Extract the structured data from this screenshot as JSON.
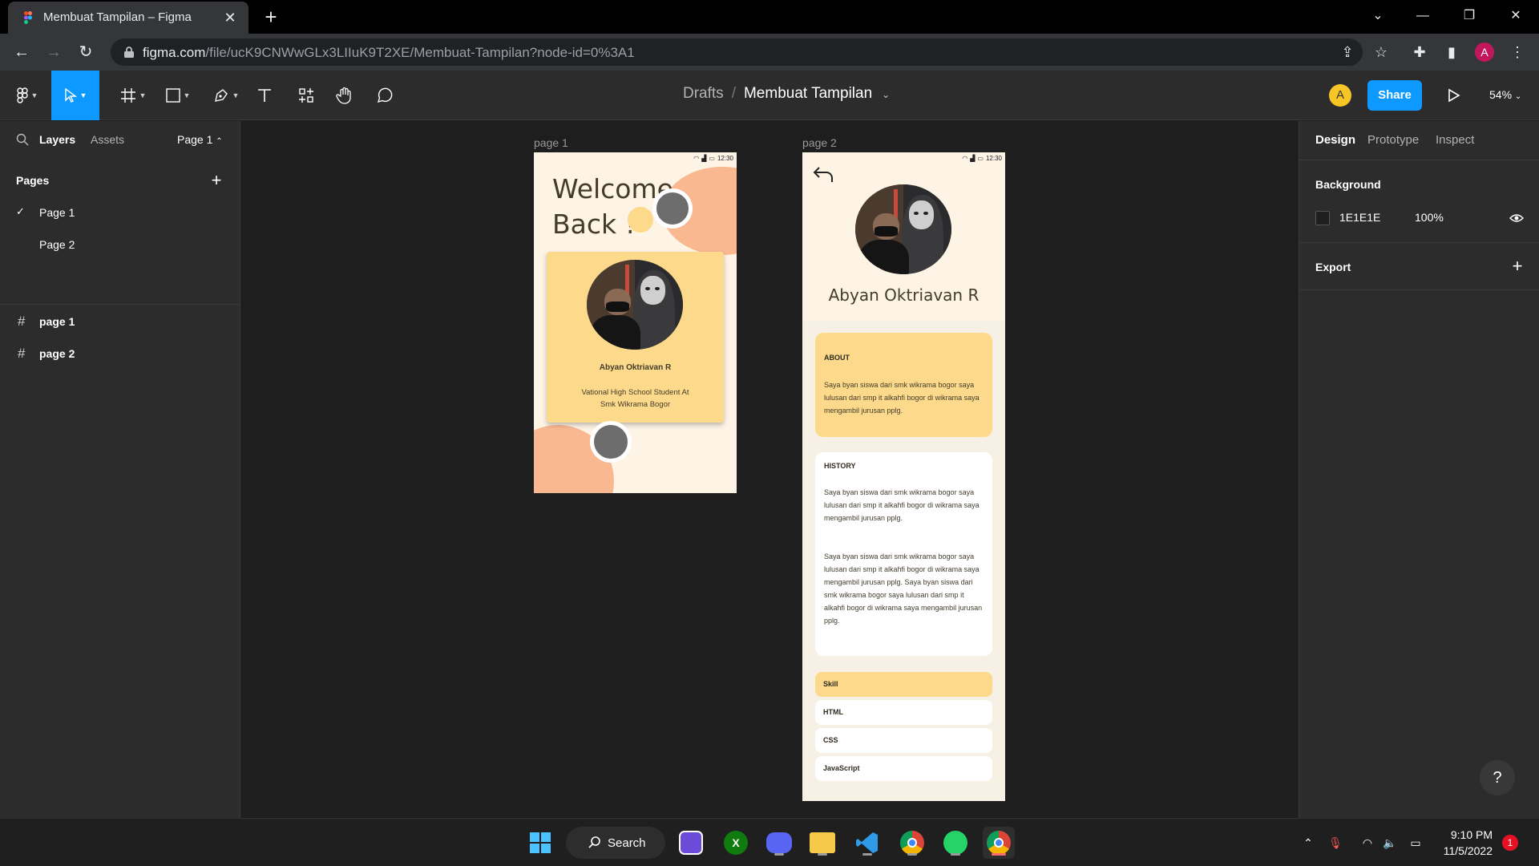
{
  "browser": {
    "tab_title": "Membuat Tampilan – Figma",
    "url_host": "figma.com",
    "url_path": "/file/ucK9CNWwGLx3LIIuK9T2XE/Membuat-Tampilan?node-id=0%3A1",
    "profile_initial": "A"
  },
  "figma": {
    "breadcrumb_parent": "Drafts",
    "breadcrumb_file": "Membuat Tampilan",
    "user_initial": "A",
    "share_label": "Share",
    "zoom": "54%"
  },
  "left_panel": {
    "tab_layers": "Layers",
    "tab_assets": "Assets",
    "current_page": "Page 1",
    "pages_title": "Pages",
    "pages": [
      "Page 1",
      "Page 2"
    ],
    "layers": [
      "page 1",
      "page 2"
    ]
  },
  "right_panel": {
    "tabs": [
      "Design",
      "Prototype",
      "Inspect"
    ],
    "background_title": "Background",
    "background_hex": "1E1E1E",
    "background_opacity": "100%",
    "export_title": "Export"
  },
  "canvas": {
    "frame1_label": "page 1",
    "frame2_label": "page 2",
    "status_time": "12:30",
    "page1": {
      "welcome_line1": "Welcome",
      "welcome_line2": "Back !",
      "name": "Abyan Oktriavan R",
      "subtitle_line1": "Vational High School Student At",
      "subtitle_line2": "Smk Wikrama Bogor"
    },
    "page2": {
      "name": "Abyan Oktriavan R",
      "about_title": "ABOUT",
      "about_text": "Saya byan siswa dari smk wikrama bogor saya lulusan dari smp it alkahfi bogor di wikrama saya mengambil jurusan pplg.",
      "history_title": "HISTORY",
      "history_text1": "Saya byan siswa dari smk wikrama bogor saya lulusan dari smp it alkahfi bogor di wikrama saya mengambil jurusan pplg.",
      "history_text2": "Saya byan siswa dari smk wikrama bogor saya lulusan dari smp it alkahfi bogor di wikrama saya mengambil jurusan pplg. Saya byan siswa dari smk wikrama bogor saya lulusan dari smp it alkahfi bogor di wikrama saya mengambil jurusan pplg.",
      "skills": [
        "Skill",
        "HTML",
        "CSS",
        "JavaScript"
      ]
    }
  },
  "taskbar": {
    "search_label": "Search",
    "time": "9:10 PM",
    "date": "11/5/2022",
    "notification_count": "1"
  },
  "colors": {
    "figma_blue": "#0d99ff",
    "card_yellow": "#fcd98b",
    "peach": "#f9b890",
    "cream": "#fdf4e6"
  }
}
